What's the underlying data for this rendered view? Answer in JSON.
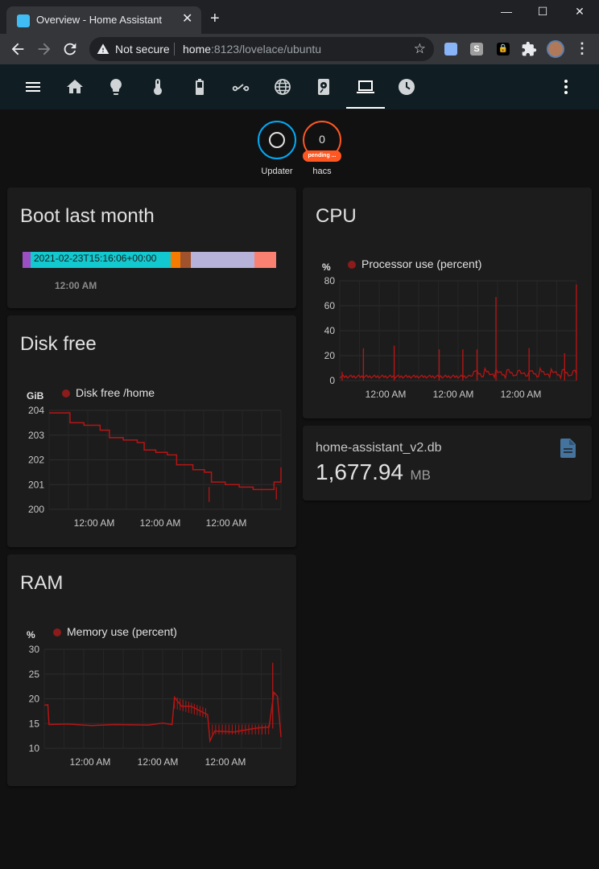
{
  "browser": {
    "tab_title": "Overview - Home Assistant",
    "url_security": "Not secure",
    "url_host": "home",
    "url_path": ":8123/lovelace/ubuntu"
  },
  "ha_header": {
    "icons": [
      "menu-icon",
      "home-icon",
      "lightbulb-icon",
      "thermometer-icon",
      "battery-icon",
      "switch-icon",
      "web-icon",
      "harddisk-icon",
      "laptop-icon",
      "clock-icon",
      "dots-vertical-icon"
    ],
    "active_index": 8
  },
  "badges": {
    "updater": {
      "label": "Updater"
    },
    "hacs": {
      "value": "0",
      "pill": "pending ...",
      "label": "hacs"
    }
  },
  "boot_card": {
    "title": "Boot last month",
    "bar_label": "2021-02-23T15:16:06+00:00",
    "time_label": "12:00 AM",
    "segments": [
      {
        "frac": 0.033,
        "color": "#9c4fc3"
      },
      {
        "frac": 0.55,
        "color": "#11c9cf"
      },
      {
        "frac": 0.04,
        "color": "#f57c00"
      },
      {
        "frac": 0.04,
        "color": "#a0522d"
      },
      {
        "frac": 0.25,
        "color": "#b7b2da"
      },
      {
        "frac": 0.087,
        "color": "#fa8072"
      }
    ]
  },
  "cpu_card": {
    "title": "CPU",
    "chart_data": {
      "type": "line",
      "unit": "%",
      "series": [
        {
          "name": "Processor use (percent)",
          "color": "#b51515"
        }
      ],
      "ylim": [
        0,
        80
      ],
      "yticks": [
        "80",
        "60",
        "40",
        "20",
        "0"
      ],
      "xticks": [
        "12:00 AM",
        "12:00 AM",
        "12:00 AM"
      ],
      "baseline": 2,
      "spikes": [
        {
          "x": 0.01,
          "y": 7
        },
        {
          "x": 0.1,
          "y": 26
        },
        {
          "x": 0.23,
          "y": 28
        },
        {
          "x": 0.42,
          "y": 25
        },
        {
          "x": 0.52,
          "y": 25
        },
        {
          "x": 0.58,
          "y": 25
        },
        {
          "x": 0.66,
          "y": 67
        },
        {
          "x": 0.8,
          "y": 26
        },
        {
          "x": 0.95,
          "y": 22
        },
        {
          "x": 1.0,
          "y": 77
        }
      ]
    }
  },
  "db_card": {
    "name": "home-assistant_v2.db",
    "value": "1,677.94",
    "unit": "MB"
  },
  "disk_card": {
    "title": "Disk free",
    "chart_data": {
      "type": "line",
      "unit": "GiB",
      "series": [
        {
          "name": "Disk free /home",
          "color": "#b51515"
        }
      ],
      "ylim": [
        200,
        204
      ],
      "yticks": [
        "204",
        "203",
        "202",
        "201",
        "200"
      ],
      "xticks": [
        "12:00 AM",
        "12:00 AM",
        "12:00 AM"
      ],
      "points": [
        [
          0.0,
          203.9
        ],
        [
          0.07,
          203.9
        ],
        [
          0.09,
          203.5
        ],
        [
          0.15,
          203.4
        ],
        [
          0.22,
          203.2
        ],
        [
          0.26,
          202.9
        ],
        [
          0.32,
          202.8
        ],
        [
          0.38,
          202.7
        ],
        [
          0.41,
          202.4
        ],
        [
          0.46,
          202.3
        ],
        [
          0.51,
          202.2
        ],
        [
          0.55,
          201.8
        ],
        [
          0.62,
          201.6
        ],
        [
          0.67,
          201.5
        ],
        [
          0.7,
          201.1
        ],
        [
          0.76,
          201.0
        ],
        [
          0.82,
          200.9
        ],
        [
          0.88,
          200.8
        ],
        [
          0.95,
          200.8
        ],
        [
          0.97,
          201.1
        ],
        [
          1.0,
          201.7
        ]
      ],
      "dips": [
        {
          "x": 0.69,
          "y": 200.3
        },
        {
          "x": 0.98,
          "y": 200.4
        }
      ]
    }
  },
  "ram_card": {
    "title": "RAM",
    "chart_data": {
      "type": "line",
      "unit": "%",
      "series": [
        {
          "name": "Memory use (percent)",
          "color": "#b51515"
        }
      ],
      "ylim": [
        10,
        30
      ],
      "yticks": [
        "30",
        "25",
        "20",
        "15",
        "10"
      ],
      "xticks": [
        "12:00 AM",
        "12:00 AM",
        "12:00 AM"
      ],
      "points": [
        [
          0.0,
          18.7
        ],
        [
          0.015,
          18.5
        ],
        [
          0.02,
          14.8
        ],
        [
          0.1,
          14.6
        ],
        [
          0.2,
          14.6
        ],
        [
          0.3,
          14.5
        ],
        [
          0.44,
          14.7
        ],
        [
          0.5,
          14.8
        ],
        [
          0.54,
          14.8
        ],
        [
          0.55,
          20
        ],
        [
          0.58,
          18.5
        ],
        [
          0.62,
          18.2
        ],
        [
          0.66,
          17.5
        ],
        [
          0.69,
          16.5
        ],
        [
          0.7,
          11.5
        ],
        [
          0.72,
          13.2
        ],
        [
          0.8,
          13.3
        ],
        [
          0.9,
          13.8
        ],
        [
          0.95,
          14.3
        ],
        [
          0.97,
          21
        ],
        [
          0.985,
          20.5
        ],
        [
          1.0,
          12
        ]
      ],
      "spike": {
        "x": 0.965,
        "y": 27.3
      }
    }
  }
}
